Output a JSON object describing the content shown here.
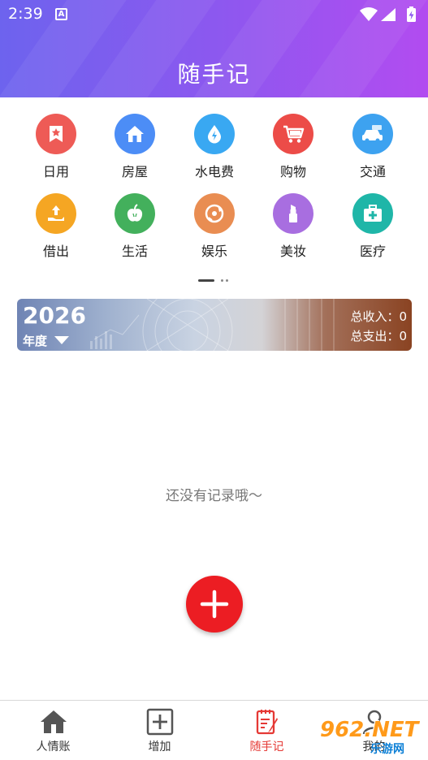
{
  "status_bar": {
    "time": "2:39",
    "notification_letter": "A"
  },
  "header": {
    "title": "随手记"
  },
  "categories": [
    {
      "label": "日用",
      "icon": "daily-icon",
      "color": "#ee5b56"
    },
    {
      "label": "房屋",
      "icon": "house-icon",
      "color": "#4c8df6"
    },
    {
      "label": "水电费",
      "icon": "utility-icon",
      "color": "#39a8f2"
    },
    {
      "label": "购物",
      "icon": "cart-icon",
      "color": "#ec4c48"
    },
    {
      "label": "交通",
      "icon": "car-icon",
      "color": "#3da2f0"
    },
    {
      "label": "借出",
      "icon": "lend-icon",
      "color": "#f5a623"
    },
    {
      "label": "生活",
      "icon": "apple-icon",
      "color": "#43b05c"
    },
    {
      "label": "娱乐",
      "icon": "entertainment-icon",
      "color": "#e98d52"
    },
    {
      "label": "美妆",
      "icon": "lipstick-icon",
      "color": "#a86ee0"
    },
    {
      "label": "医疗",
      "icon": "medical-kit-icon",
      "color": "#1fb6a8"
    }
  ],
  "year_banner": {
    "year": "2026",
    "unit": "年度",
    "income_label": "总收入：",
    "income_value": "0",
    "expense_label": "总支出：",
    "expense_value": "0"
  },
  "empty_state": {
    "text": "还没有记录哦～"
  },
  "fab": {
    "icon": "plus-icon",
    "color": "#ec1d23"
  },
  "tabbar": {
    "tabs": [
      {
        "label": "人情账",
        "icon": "home-icon",
        "active": false
      },
      {
        "label": "增加",
        "icon": "add-square-icon",
        "active": false
      },
      {
        "label": "随手记",
        "icon": "notebook-icon",
        "active": true
      },
      {
        "label": "我的",
        "icon": "user-icon",
        "active": false
      }
    ]
  },
  "watermark": {
    "text": "962.NET",
    "subtext": "乐游网"
  },
  "colors": {
    "accent": "#e53935",
    "header_start": "#6d63ee",
    "header_end": "#b24cf0"
  }
}
